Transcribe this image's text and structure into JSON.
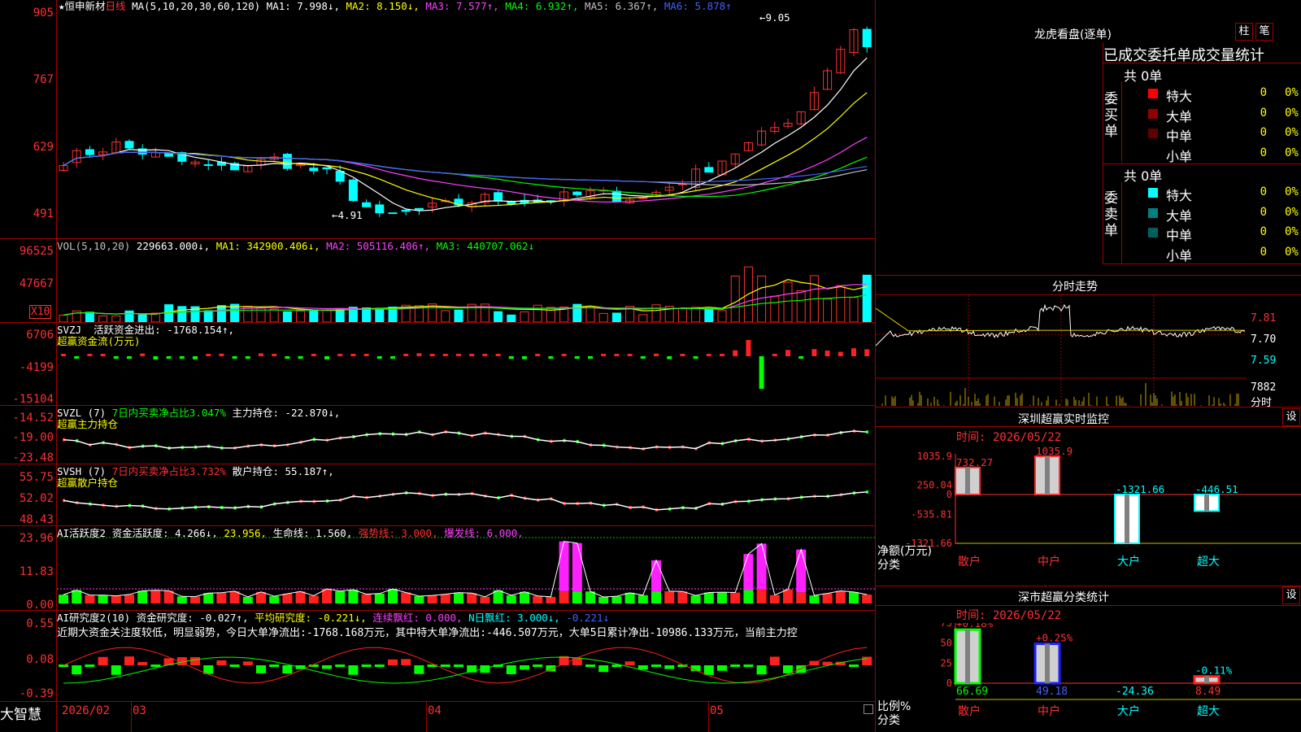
{
  "stock": {
    "star": "★",
    "name": "恒申新材",
    "period": "日线"
  },
  "ma_title": "MA(5,10,20,30,60,120)",
  "ma": [
    {
      "label": "MA1: 7.998↓,",
      "color": "#ffffff"
    },
    {
      "label": "MA2: 8.150↓,",
      "color": "#ffff00"
    },
    {
      "label": "MA3: 7.577↑,",
      "color": "#ff40ff"
    },
    {
      "label": "MA4: 6.932↑,",
      "color": "#00ff00"
    },
    {
      "label": "MA5: 6.367↑,",
      "color": "#c0c0c0"
    },
    {
      "label": "MA6: 5.878↑",
      "color": "#4060ff"
    }
  ],
  "price_axis": [
    "905",
    "767",
    "629",
    "491"
  ],
  "price_high": "9.05",
  "price_low": "4.91",
  "vol_title": "VOL(5,10,20)",
  "vol_value": "229663.000↓,",
  "vol_ma": [
    {
      "label": "MA1: 342900.406↓,",
      "color": "#ffff00"
    },
    {
      "label": "MA2: 505116.406↑,",
      "color": "#ff40ff"
    },
    {
      "label": "MA3: 440707.062↓",
      "color": "#00ff00"
    }
  ],
  "vol_axis": [
    "96525",
    "47667"
  ],
  "vol_unit": "X10",
  "svzj": {
    "name": "SVZJ",
    "desc": "活跃资金进出: -1768.154↑,",
    "sub": "超赢资金流(万元)",
    "axis": [
      "6706",
      "-4199",
      "-15104"
    ]
  },
  "svzl": {
    "name": "SVZL (7)",
    "desc1": "7日内买卖净占比3.047%",
    "desc2": "主力持仓: -22.870↓,",
    "sub": "超赢主力持仓",
    "axis": [
      "-14.52",
      "-19.00",
      "-23.48"
    ]
  },
  "svsh": {
    "name": "SVSH (7)",
    "desc1": "7日内买卖净占比3.732%",
    "desc2": "散户持仓: 55.187↑,",
    "sub": "超赢散户持仓",
    "axis": [
      "55.75",
      "52.02",
      "48.43"
    ]
  },
  "ai1": {
    "name": "AI活跃度2",
    "desc": "资金活跃度: 4.266↓,",
    "v2": "23.956,",
    "v3": "生命线: 1.560,",
    "v4": "强势线: 3.000,",
    "v5": "爆发线: 6.000,",
    "axis": [
      "23.96",
      "11.83",
      "0.00"
    ]
  },
  "ai2": {
    "name": "AI研究度2(10)",
    "desc": "资金研究度: -0.027↑,",
    "v2": "平均研究度: -0.221↓,",
    "v3": "连续飘红: 0.000,",
    "v4": "N日飘红: 3.000↓,",
    "v5": "-0.221↓",
    "comment": "近期大资金关注度较低，明显弱势，今日大单净流出:-1768.168万元，其中特大单净流出:-446.507万元，大单5日累计净出-10986.133万元，当前主力控",
    "axis": [
      "0.55",
      "0.08",
      "-0.39"
    ]
  },
  "dates": {
    "year": "2026/02",
    "m3": "03",
    "m4": "04",
    "m5": "05"
  },
  "brand": "大智慧",
  "lhb": {
    "title": "龙虎看盘(逐单)",
    "btn1": "柱",
    "btn2": "笔",
    "subtitle": "已成交委托单成交量统计",
    "buy": {
      "side": "委买单",
      "total": "共 0单",
      "rows": [
        {
          "name": "特大",
          "v": "0",
          "p": "0%",
          "color": "#ff0000"
        },
        {
          "name": "大单",
          "v": "0",
          "p": "0%",
          "color": "#900000"
        },
        {
          "name": "中单",
          "v": "0",
          "p": "0%",
          "color": "#600000"
        },
        {
          "name": "小单",
          "v": "0",
          "p": "0%",
          "color": "#000000"
        }
      ]
    },
    "sell": {
      "side": "委卖单",
      "total": "共 0单",
      "rows": [
        {
          "name": "特大",
          "v": "0",
          "p": "0%",
          "color": "#00ffff"
        },
        {
          "name": "大单",
          "v": "0",
          "p": "0%",
          "color": "#008080"
        },
        {
          "name": "中单",
          "v": "0",
          "p": "0%",
          "color": "#006060"
        },
        {
          "name": "小单",
          "v": "0",
          "p": "0%",
          "color": "#000000"
        }
      ]
    }
  },
  "fenshi": {
    "title": "分时走势",
    "axis": [
      "7.81",
      "7.70",
      "7.59"
    ],
    "vol": "7882",
    "vol_unit": "分时"
  },
  "monitor": {
    "title": "深圳超赢实时监控",
    "btn": "设",
    "time": "时间: 2026/05/22",
    "axis": [
      "1035.9",
      "250.04",
      "0",
      "-535.81",
      "-1321.66"
    ],
    "ylabel": "净额(万元)",
    "xlabel": "分类",
    "bars": [
      {
        "cat": "散户",
        "value": 732.27,
        "label": "732.27"
      },
      {
        "cat": "中户",
        "value": 1035.9,
        "label": "1035.9"
      },
      {
        "cat": "大户",
        "value": -1321.66,
        "label": "-1321.66"
      },
      {
        "cat": "超大",
        "value": -446.51,
        "label": "-446.51"
      }
    ]
  },
  "cls": {
    "title": "深市超赢分类统计",
    "btn": "设",
    "time": "时间: 2026/05/22",
    "axis": [
      "75",
      "50",
      "25",
      "0"
    ],
    "ylabel": "比例%",
    "xlabel": "分类",
    "bars": [
      {
        "cat": "散户",
        "value": 66.69,
        "label": "66.69",
        "chg": "+0.18%",
        "color": "#00ff00"
      },
      {
        "cat": "中户",
        "value": 49.18,
        "label": "49.18",
        "chg": "+0.25%",
        "color": "#2020ff"
      },
      {
        "cat": "大户",
        "value": -24.36,
        "label": "-24.36",
        "chg": "",
        "color": "#00ffff"
      },
      {
        "cat": "超大",
        "value": 8.49,
        "label": "8.49",
        "chg": "-0.11%",
        "color": "#ff2020"
      }
    ]
  }
}
